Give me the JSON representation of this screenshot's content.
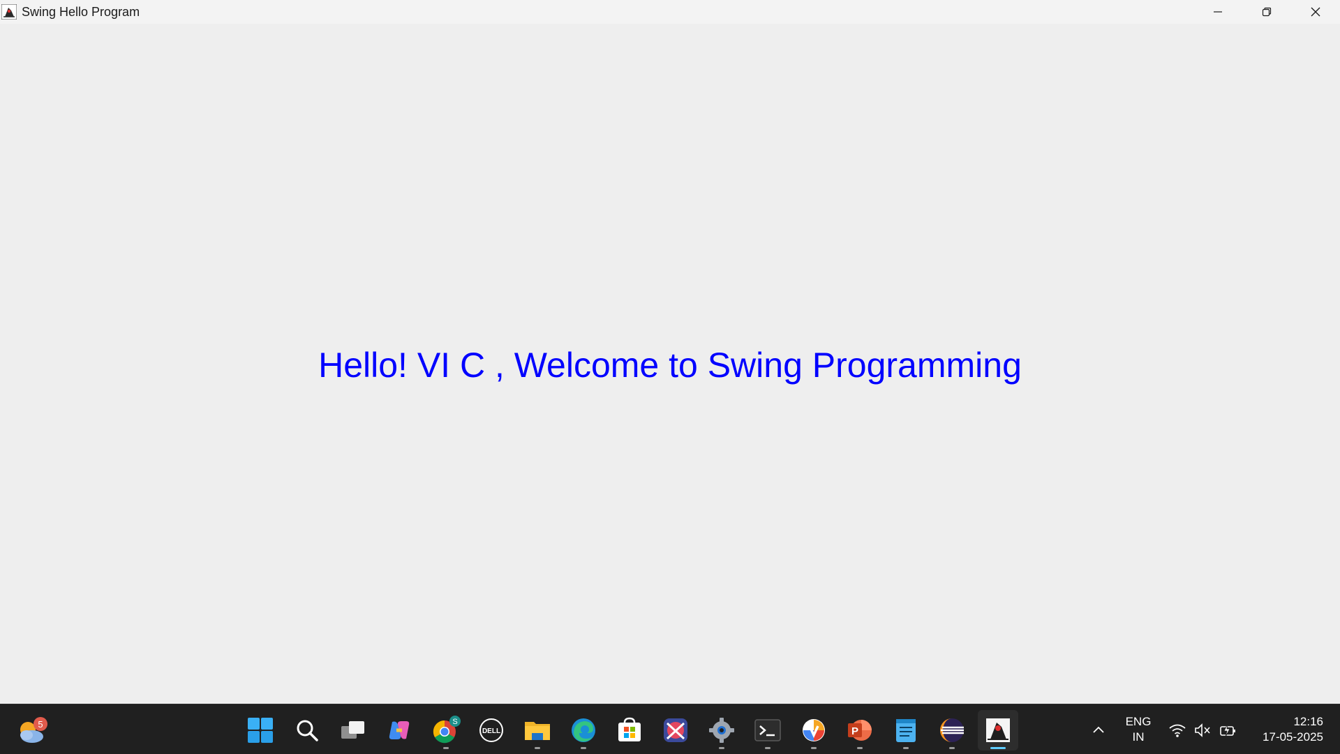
{
  "window": {
    "title": "Swing Hello Program",
    "app_icon": "java-duke-icon",
    "controls": {
      "minimize": "minimize-icon",
      "maximize": "restore-icon",
      "close": "close-icon"
    }
  },
  "content": {
    "label": "Hello! VI C , Welcome to Swing Programming",
    "label_color": "#0000ff"
  },
  "taskbar": {
    "weather_badge": "5",
    "pinned": [
      {
        "name": "start",
        "icon": "windows-start-icon"
      },
      {
        "name": "search",
        "icon": "search-icon"
      },
      {
        "name": "task-view",
        "icon": "task-view-icon"
      },
      {
        "name": "copilot",
        "icon": "copilot-icon"
      },
      {
        "name": "chrome",
        "icon": "chrome-icon",
        "badge": "S"
      },
      {
        "name": "dell",
        "icon": "dell-icon"
      },
      {
        "name": "file-explorer",
        "icon": "folder-icon"
      },
      {
        "name": "edge",
        "icon": "edge-icon"
      },
      {
        "name": "store",
        "icon": "store-icon"
      },
      {
        "name": "snipping",
        "icon": "snipping-icon"
      },
      {
        "name": "settings",
        "icon": "gear-icon"
      },
      {
        "name": "terminal",
        "icon": "terminal-icon"
      },
      {
        "name": "vpn",
        "icon": "vpn-icon"
      },
      {
        "name": "powerpoint",
        "icon": "powerpoint-icon"
      },
      {
        "name": "notepad",
        "icon": "notepad-icon"
      },
      {
        "name": "eclipse",
        "icon": "eclipse-icon"
      },
      {
        "name": "java-app",
        "icon": "java-duke-icon"
      }
    ],
    "language": {
      "line1": "ENG",
      "line2": "IN"
    },
    "clock": {
      "time": "12:16",
      "date": "17-05-2025"
    }
  }
}
